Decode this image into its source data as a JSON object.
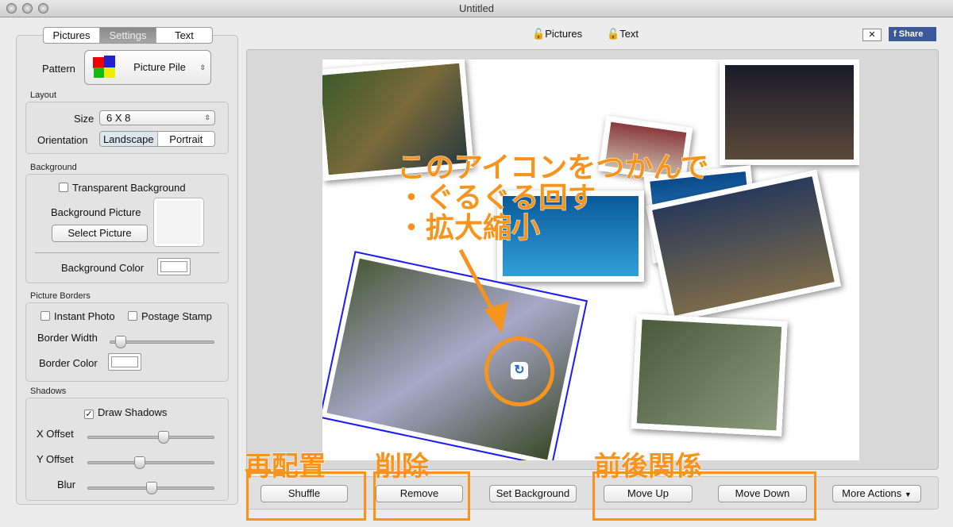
{
  "window": {
    "title": "Untitled"
  },
  "sidebar": {
    "tabs": [
      {
        "label": "Pictures"
      },
      {
        "label": "Settings",
        "selected": true
      },
      {
        "label": "Text"
      }
    ],
    "pattern": {
      "label": "Pattern",
      "value": "Picture Pile"
    },
    "layout": {
      "title": "Layout",
      "size_label": "Size",
      "size_value": "6 X 8",
      "orientation_label": "Orientation",
      "orientation_options": [
        "Landscape",
        "Portrait"
      ],
      "orientation_selected": "Landscape"
    },
    "background": {
      "title": "Background",
      "transparent_label": "Transparent Background",
      "transparent_checked": false,
      "picture_label": "Background Picture",
      "select_picture": "Select Picture",
      "color_label": "Background Color",
      "color": "#ffffff"
    },
    "borders": {
      "title": "Picture Borders",
      "instant_photo": "Instant Photo",
      "postage_stamp": "Postage Stamp",
      "width_label": "Border Width",
      "width_value": 0.05,
      "color_label": "Border Color",
      "color": "#ffffff"
    },
    "shadows": {
      "title": "Shadows",
      "draw_label": "Draw Shadows",
      "draw_checked": true,
      "x_label": "X Offset",
      "x_value": 0.6,
      "y_label": "Y Offset",
      "y_value": 0.4,
      "blur_label": "Blur",
      "blur_value": 0.5
    }
  },
  "toolbar": {
    "pictures": "Pictures",
    "text": "Text",
    "share": "Share"
  },
  "actions": {
    "shuffle": "Shuffle",
    "remove": "Remove",
    "set_background": "Set Background",
    "move_up": "Move Up",
    "move_down": "Move Down",
    "more": "More Actions"
  },
  "annotations": {
    "line1": "このアイコンをつかんで",
    "line2": "・ぐるぐる回す",
    "line3": "・拡大縮小",
    "shuffle": "再配置",
    "remove": "削除",
    "order": "前後関係"
  },
  "colors": {
    "annotation": "#f7941d",
    "selection": "#1a1aff",
    "facebook": "#3b5998"
  }
}
